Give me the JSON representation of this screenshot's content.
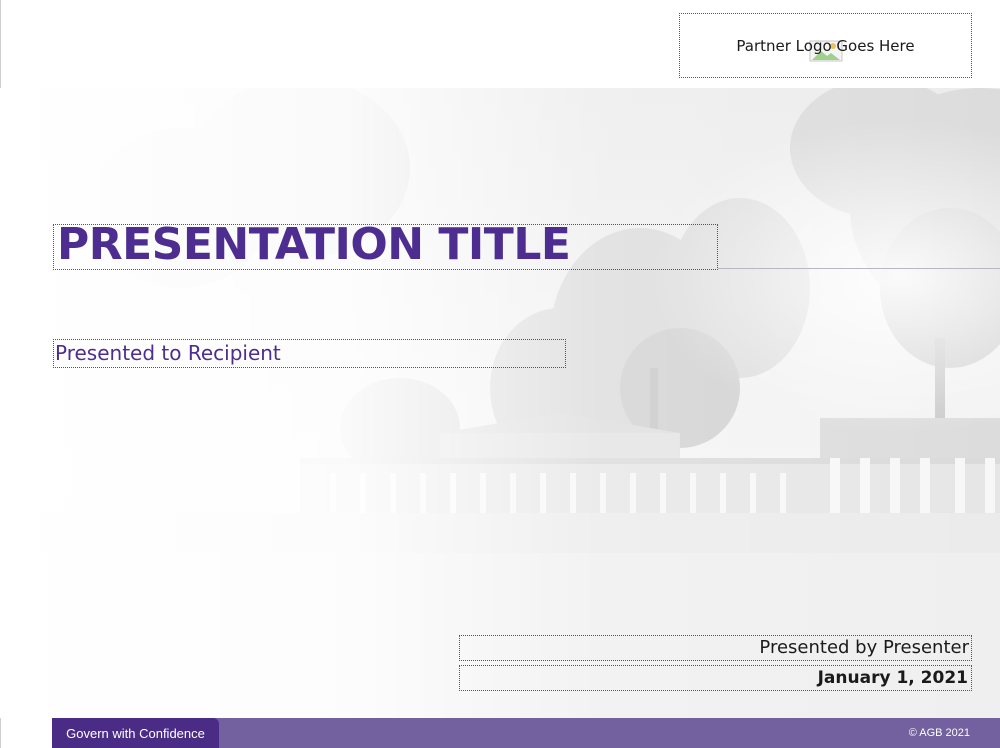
{
  "slide": {
    "title": "PRESENTATION TITLE",
    "recipient": "Presented to Recipient",
    "presenter": "Presented by Presenter",
    "date": "January 1, 2021"
  },
  "logo": {
    "placeholder_text": "Partner Logo Goes Here",
    "icon": "image-placeholder-icon"
  },
  "footer": {
    "tagline": "Govern with Confidence",
    "copyright": "© AGB 2021"
  },
  "colors": {
    "title_purple": "#4d2d8f",
    "footer_bar": "#72609f",
    "footer_tag": "#4a2c86"
  }
}
